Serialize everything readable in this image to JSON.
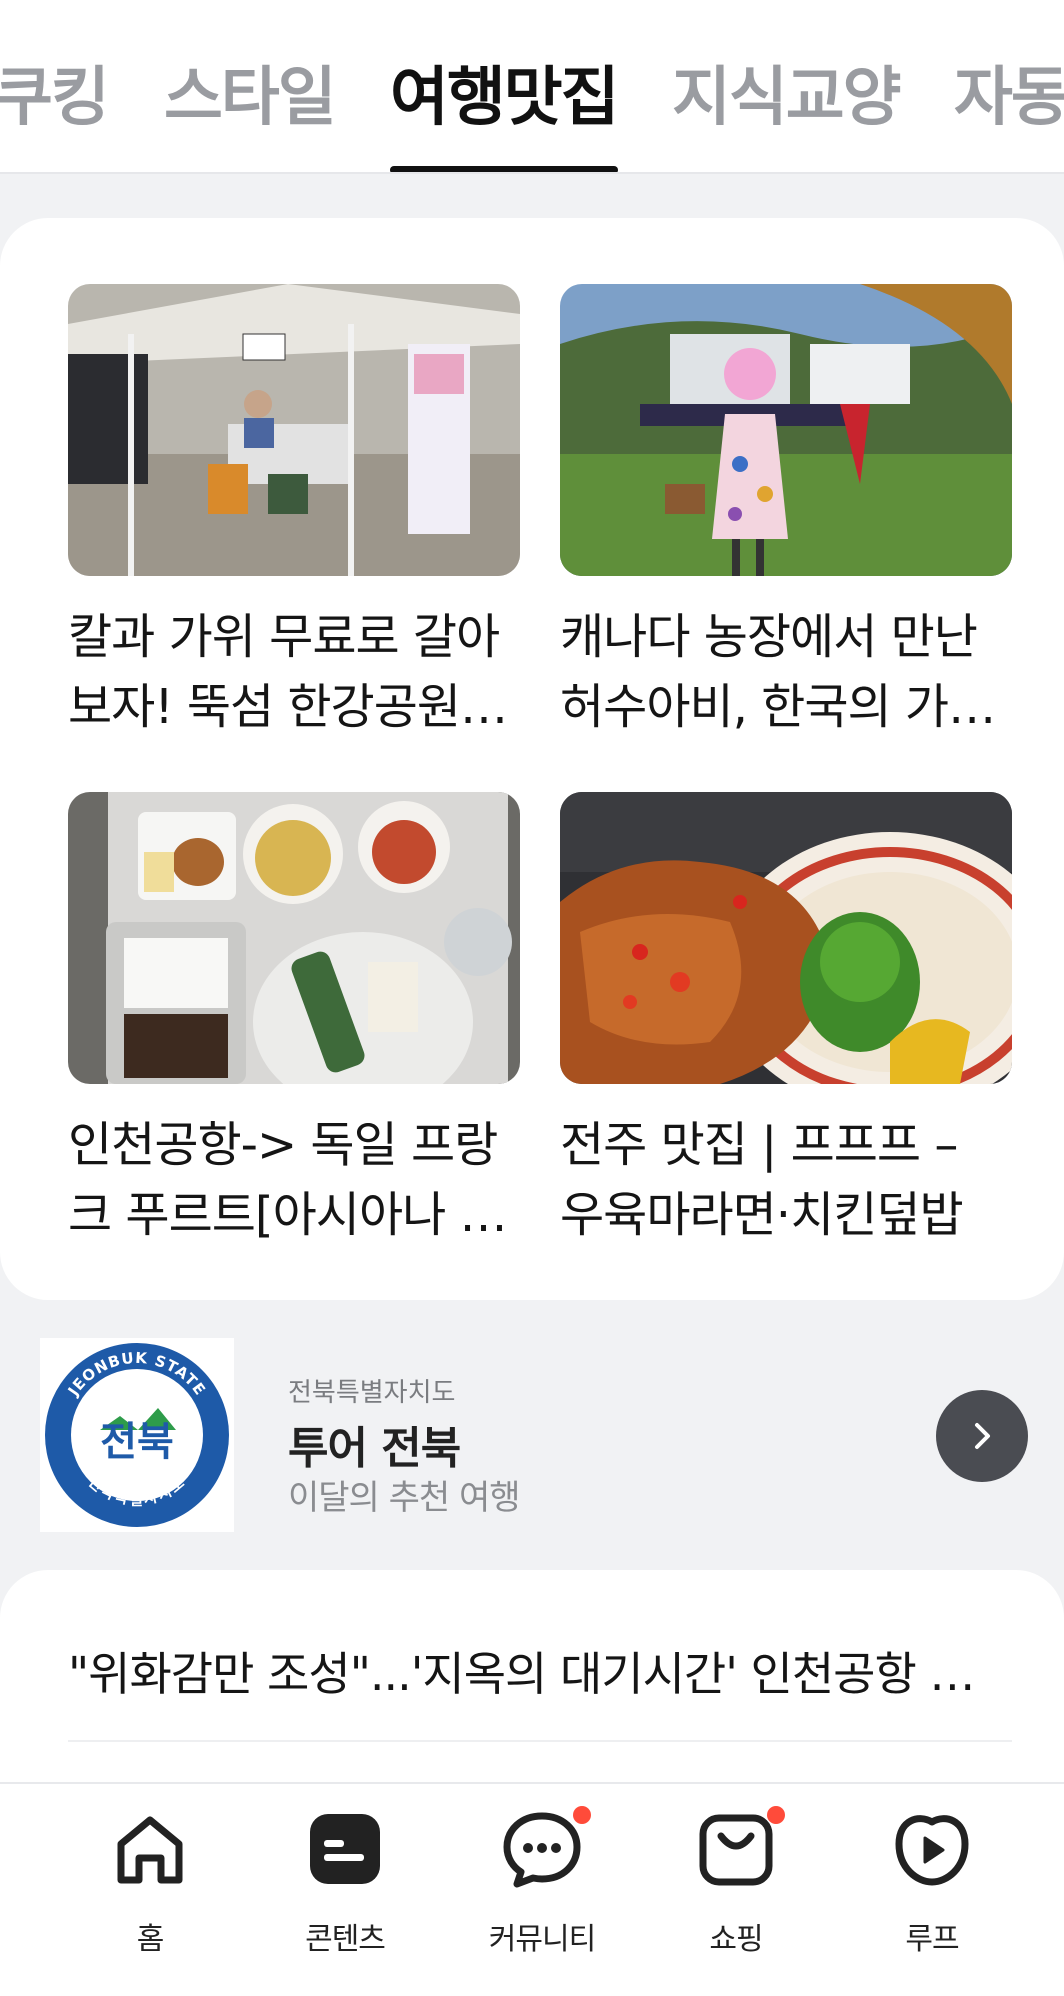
{
  "tabs": [
    {
      "label": "쿠킹",
      "active": false
    },
    {
      "label": "스타일",
      "active": false
    },
    {
      "label": "여행맛집",
      "active": true
    },
    {
      "label": "지식교양",
      "active": false
    },
    {
      "label": "자동",
      "active": false
    }
  ],
  "articles": [
    {
      "title": "칼과 가위 무료로 갈아보자! 뚝섬 한강공원에서 열린 행사",
      "image": "outdoor-market-umbrella-photo"
    },
    {
      "title": "캐나다 농장에서 만난 허수아비, 한국의 가을 풍경",
      "image": "scarecrow-garden-photo"
    },
    {
      "title": "인천공항-> 독일 프랑크 푸르트[아시아나 기내식]",
      "image": "airline-meal-tray-photo"
    },
    {
      "title": "전주 맛집 | 프프프 – 우육마라면·치킨덮밥",
      "image": "fried-chicken-bowl-photo"
    }
  ],
  "banner": {
    "org": "전북특별자치도",
    "title": "투어 전북",
    "subtitle": "이달의 추천 여행",
    "logo_text": "전북",
    "logo_ring_top": "JEONBUK STATE",
    "logo_ring_bottom": "전북특별자치도"
  },
  "news": {
    "headline": "\"위화감만 조성\"...'지옥의 대기시간' 인천공항 논란"
  },
  "bottom_nav": [
    {
      "label": "홈",
      "icon": "home-icon",
      "badge": false
    },
    {
      "label": "콘텐츠",
      "icon": "content-icon",
      "badge": false
    },
    {
      "label": "커뮤니티",
      "icon": "chat-bubble-icon",
      "badge": true
    },
    {
      "label": "쇼핑",
      "icon": "shopping-bag-icon",
      "badge": true
    },
    {
      "label": "루프",
      "icon": "play-loop-icon",
      "badge": false
    }
  ],
  "colors": {
    "accent_badge": "#ff4b3a",
    "active_tab": "#111111",
    "inactive_tab": "#9a9ca1",
    "logo_blue": "#1e5aa8"
  }
}
